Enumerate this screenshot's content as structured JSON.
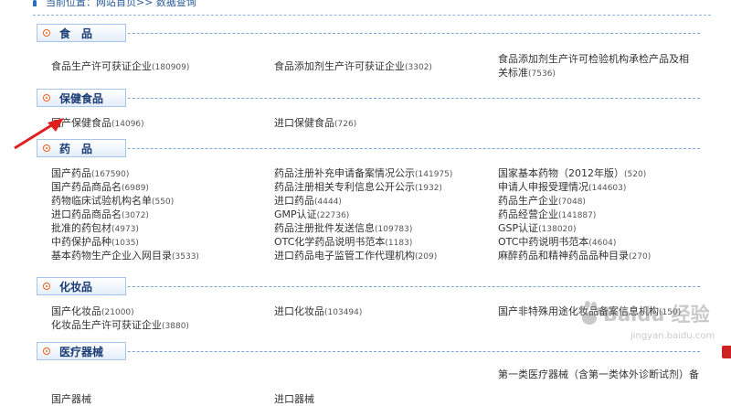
{
  "breadcrumb": {
    "text": "当前位置：网站首页>> 数据查询"
  },
  "sections": [
    {
      "title": "食　品",
      "items": [
        {
          "label": "食品生产许可获证企业",
          "count": "(180909)"
        },
        {
          "label": "食品添加剂生产许可获证企业",
          "count": "(3302)"
        },
        {
          "label": "食品添加剂生产许可检验机构承检产品及相关标准",
          "count": "(7536)"
        }
      ]
    },
    {
      "title": "保健食品",
      "items": [
        {
          "label": "国产保健食品",
          "count": "(14096)"
        },
        {
          "label": "进口保健食品",
          "count": "(726)"
        }
      ]
    },
    {
      "title": "药　品",
      "items": [
        {
          "label": "国产药品",
          "count": "(167590)"
        },
        {
          "label": "药品注册补充申请备案情况公示",
          "count": "(141975)"
        },
        {
          "label": "国家基本药物（2012年版）",
          "count": "(520)"
        },
        {
          "label": "国产药品商品名",
          "count": "(6989)"
        },
        {
          "label": "药品注册相关专利信息公开公示",
          "count": "(1932)"
        },
        {
          "label": "申请人申报受理情况",
          "count": "(144603)"
        },
        {
          "label": "药物临床试验机构名单",
          "count": "(550)"
        },
        {
          "label": "进口药品",
          "count": "(4444)"
        },
        {
          "label": "药品生产企业",
          "count": "(7048)"
        },
        {
          "label": "进口药品商品名",
          "count": "(3072)"
        },
        {
          "label": "GMP认证",
          "count": "(22736)"
        },
        {
          "label": "药品经营企业",
          "count": "(141887)"
        },
        {
          "label": "批准的药包材",
          "count": "(4973)"
        },
        {
          "label": "药品注册批件发送信息",
          "count": "(109783)"
        },
        {
          "label": "GSP认证",
          "count": "(138020)"
        },
        {
          "label": "中药保护品种",
          "count": "(1035)"
        },
        {
          "label": "OTC化学药品说明书范本",
          "count": "(1183)"
        },
        {
          "label": "OTC中药说明书范本",
          "count": "(4604)"
        },
        {
          "label": "基本药物生产企业入网目录",
          "count": "(3533)"
        },
        {
          "label": "进口药品电子监管工作代理机构",
          "count": "(209)"
        },
        {
          "label": "麻醉药品和精神药品品种目录",
          "count": "(270)"
        }
      ]
    },
    {
      "title": "化妆品",
      "items": [
        {
          "label": "国产化妆品",
          "count": "(21000)"
        },
        {
          "label": "进口化妆品",
          "count": "(103494)"
        },
        {
          "label": "国产非特殊用途化妆品备案信息机构",
          "count": "(150)"
        },
        {
          "label": "化妆品生产许可获证企业",
          "count": "(3880)"
        }
      ]
    },
    {
      "title": "医疗器械",
      "items": [
        {
          "label": "国产器械",
          "count": ""
        },
        {
          "label": "进口器械",
          "count": ""
        },
        {
          "label": "第一类医疗器械（含第一类体外诊断试剂）备",
          "count": ""
        }
      ]
    }
  ],
  "watermark": {
    "text": "Baidu 经验",
    "url": "jingyan.baidu.com"
  },
  "colors": {
    "link": "#333333",
    "accent": "#e8601c",
    "header": "#1a3b73",
    "dash": "#7aa6d8",
    "arrow": "#e02020"
  }
}
